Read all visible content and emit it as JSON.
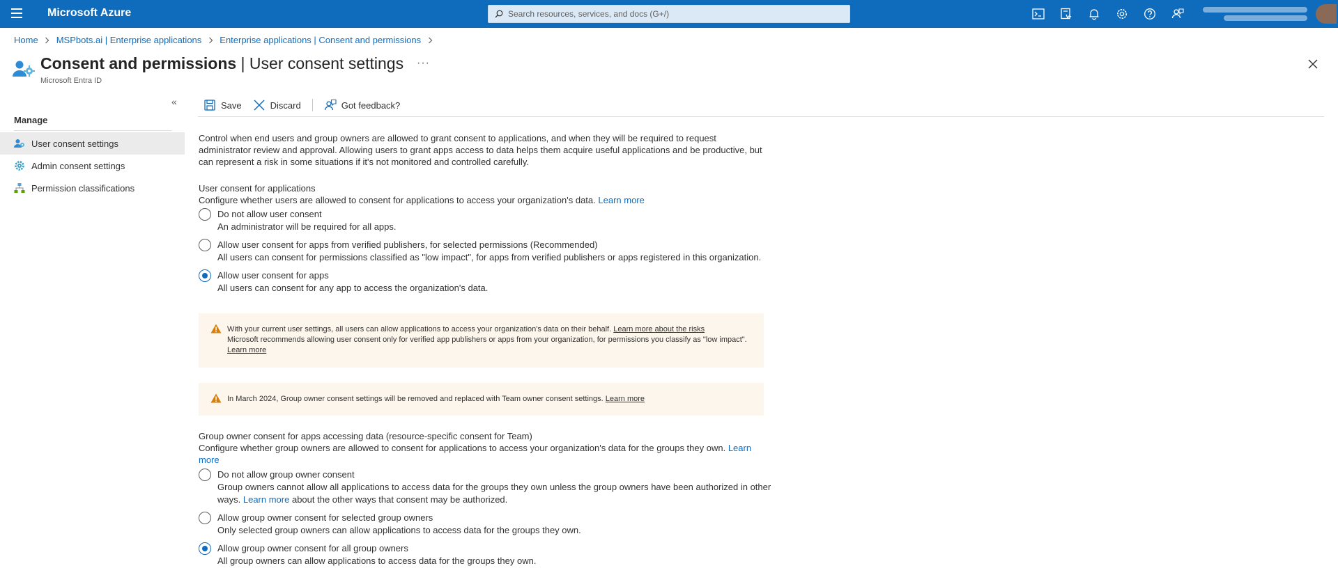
{
  "colors": {
    "accent": "#0f6cbd",
    "warning": "#d67f0b",
    "topbar": "#0f6cbd"
  },
  "topbar": {
    "brand": "Microsoft Azure",
    "search_placeholder": "Search resources, services, and docs (G+/)",
    "icons": [
      "cloud-shell-icon",
      "directory-filter-icon",
      "notifications-icon",
      "settings-icon",
      "help-icon",
      "feedback-icon"
    ]
  },
  "breadcrumb": [
    "Home",
    "MSPbots.ai | Enterprise applications",
    "Enterprise applications | Consent and permissions"
  ],
  "page": {
    "title_bold": "Consent and permissions",
    "title_rest": " | User consent settings",
    "more": "···",
    "subtitle": "Microsoft Entra ID"
  },
  "sidebar": {
    "collapse": "«",
    "heading": "Manage",
    "items": [
      {
        "label": "User consent settings",
        "icon": "user-consent-icon",
        "active": true
      },
      {
        "label": "Admin consent settings",
        "icon": "gear-icon",
        "active": false
      },
      {
        "label": "Permission classifications",
        "icon": "hierarchy-icon",
        "active": false
      }
    ]
  },
  "toolbar": {
    "save": "Save",
    "discard": "Discard",
    "feedback": "Got feedback?"
  },
  "intro": "Control when end users and group owners are allowed to grant consent to applications, and when they will be required to request administrator review and approval. Allowing users to grant apps access to data helps them acquire useful applications and be productive, but can represent a risk in some situations if it's not monitored and controlled carefully.",
  "user_consent": {
    "title": "User consent for applications",
    "desc": "Configure whether users are allowed to consent for applications to access your organization's data.",
    "learn_more": "Learn more",
    "options": [
      {
        "label": "Do not allow user consent",
        "desc": "An administrator will be required for all apps.",
        "checked": false
      },
      {
        "label": "Allow user consent for apps from verified publishers, for selected permissions (Recommended)",
        "desc": "All users can consent for permissions classified as \"low impact\", for apps from verified publishers or apps registered in this organization.",
        "checked": false
      },
      {
        "label": "Allow user consent for apps",
        "desc": "All users can consent for any app to access the organization's data.",
        "checked": true
      }
    ]
  },
  "warning1": {
    "text1": "With your current user settings, all users can allow applications to access your organization's data on their behalf.",
    "link1": "Learn more about the risks",
    "text2": "Microsoft recommends allowing user consent only for verified app publishers or apps from your organization, for permissions you classify as \"low impact\".",
    "link2": "Learn more"
  },
  "warning2": {
    "text": "In March 2024, Group owner consent settings will be removed and replaced with Team owner consent settings.",
    "link": "Learn more"
  },
  "group_consent": {
    "title": "Group owner consent for apps accessing data (resource-specific consent for Team)",
    "desc": "Configure whether group owners are allowed to consent for applications to access your organization's data for the groups they own.",
    "learn_more": "Learn more",
    "options": [
      {
        "label": "Do not allow group owner consent",
        "desc_pre": "Group owners cannot allow all applications to access data for the groups they own unless the group owners have been authorized in other ways.",
        "desc_link": "Learn more",
        "desc_post": "about the other ways that consent may be authorized.",
        "checked": false
      },
      {
        "label": "Allow group owner consent for selected group owners",
        "desc": "Only selected group owners can allow applications to access data for the groups they own.",
        "checked": false
      },
      {
        "label": "Allow group owner consent for all group owners",
        "desc": "All group owners can allow applications to access data for the groups they own.",
        "checked": true
      }
    ]
  }
}
